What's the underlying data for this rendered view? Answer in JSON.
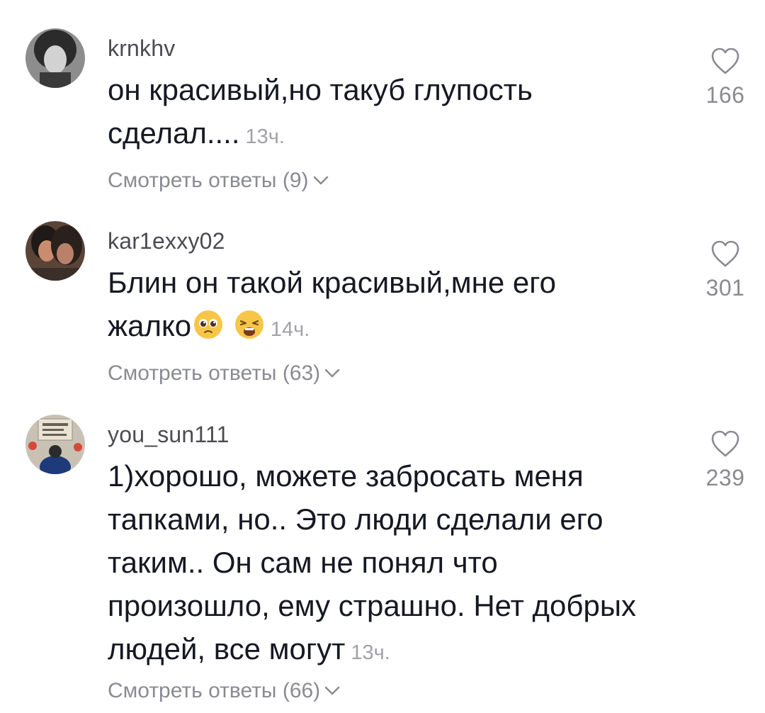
{
  "comments": [
    {
      "username": "krnkhv",
      "text": "он красивый,но такуб глупость\nсделал....",
      "time": "13ч.",
      "replies_label": "Смотреть ответы (9)",
      "likes": "166"
    },
    {
      "username": "kar1exxy02",
      "text": "Блин он такой красивый,мне его\nжалко",
      "emojis": [
        "pleading-face-icon",
        "weary-face-icon"
      ],
      "time": "14ч.",
      "replies_label": "Смотреть ответы (63)",
      "likes": "301"
    },
    {
      "username": "you_sun111",
      "text": "1)хорошо, можете забросать меня\nтапками, но.. Это люди сделали его\nтаким.. Он сам не понял что\nпроизошло, ему страшно. Нет добрых\nлюдей, все могут",
      "time": "13ч.",
      "replies_label": "Смотреть ответы (66)",
      "likes": "239"
    }
  ]
}
